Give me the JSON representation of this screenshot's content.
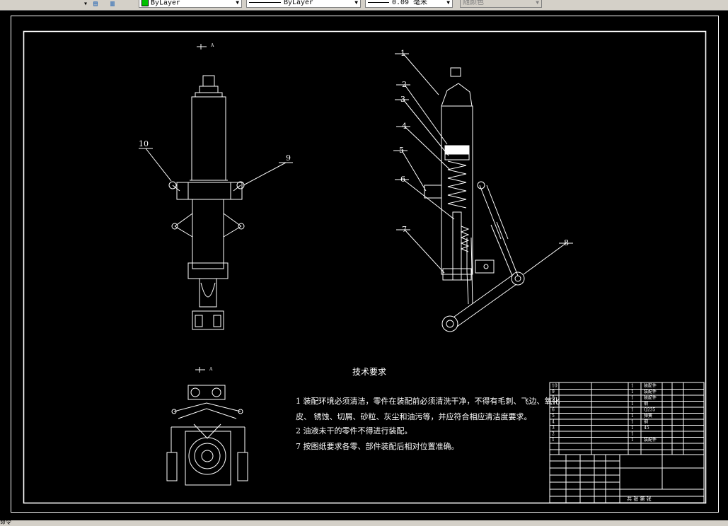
{
  "toolbar": {
    "color_value": "ByLayer",
    "linetype_value": "ByLayer",
    "lineweight_value": "0.09 毫米",
    "plotstyle_value": "随颜色"
  },
  "drawing": {
    "view_marker_top": "A",
    "view_marker_bottom": "A",
    "callouts": [
      "1",
      "2",
      "3",
      "4",
      "5",
      "6",
      "7",
      "8",
      "9",
      "10"
    ],
    "notes_title": "技术要求",
    "notes": [
      "1 装配环境必须清洁，零件在装配前必须清洗干净，不得有毛刺、飞边、氧化",
      "皮、  锈蚀、切屑、砂粒、灰尘和油污等，并应符合相应清洁度要求。",
      "2 油液未干的零件不得进行装配。",
      "7 按图纸要求各零、部件装配后相对位置准确。"
    ],
    "bom_rows": [
      {
        "no": "10",
        "qty": "1",
        "mat": "装配件"
      },
      {
        "no": "9",
        "qty": "1",
        "mat": "装配件"
      },
      {
        "no": "8",
        "qty": "1",
        "mat": "装配件"
      },
      {
        "no": "7",
        "qty": "1",
        "mat": "钢"
      },
      {
        "no": "6",
        "qty": "1",
        "mat": "Q235"
      },
      {
        "no": "5",
        "qty": "1",
        "mat": "弹簧"
      },
      {
        "no": "4",
        "qty": "1",
        "mat": "钢"
      },
      {
        "no": "3",
        "qty": "1",
        "mat": "45"
      },
      {
        "no": "2",
        "qty": "1",
        "mat": ""
      },
      {
        "no": "1",
        "qty": "1",
        "mat": "装配件"
      }
    ],
    "title_block_footer": "共 张 第 张"
  },
  "status": {
    "text": "命令"
  }
}
